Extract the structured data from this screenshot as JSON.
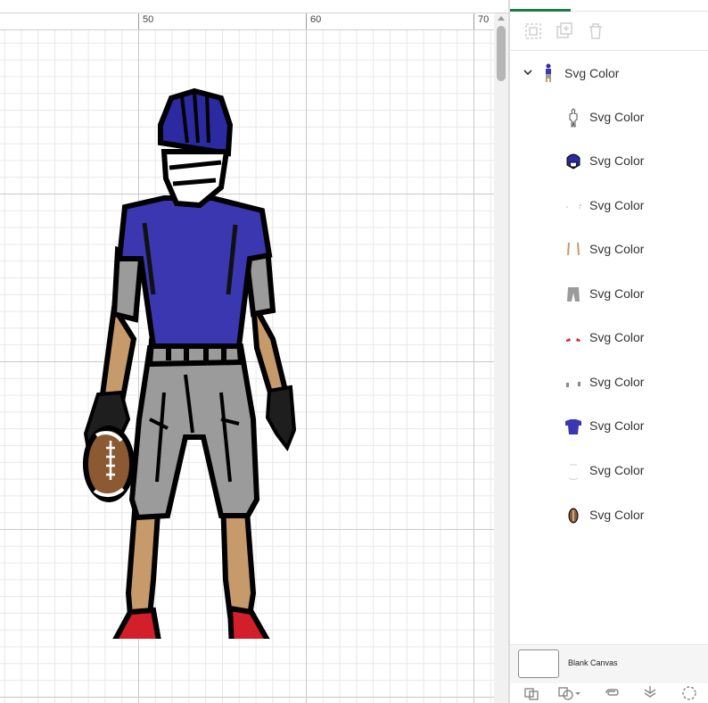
{
  "ruler": {
    "labels": [
      "50",
      "60",
      "70"
    ]
  },
  "layers": {
    "group": {
      "label": "Svg Color",
      "icon": "chevron-down-icon"
    },
    "items": [
      {
        "label": "Svg Color",
        "thumb": "outline"
      },
      {
        "label": "Svg Color",
        "thumb": "helmet"
      },
      {
        "label": "Svg Color",
        "thumb": "specks"
      },
      {
        "label": "Svg Color",
        "thumb": "arms"
      },
      {
        "label": "Svg Color",
        "thumb": "pants"
      },
      {
        "label": "Svg Color",
        "thumb": "shoes"
      },
      {
        "label": "Svg Color",
        "thumb": "socks"
      },
      {
        "label": "Svg Color",
        "thumb": "jersey"
      },
      {
        "label": "Svg Color",
        "thumb": "laces"
      },
      {
        "label": "Svg Color",
        "thumb": "football"
      }
    ]
  },
  "canvas_bar": {
    "label": "Blank Canvas"
  },
  "colors": {
    "accent": "#1d7a4b",
    "jersey": "#3a37b0",
    "pants": "#9b9b9b",
    "skin": "#c79a6b",
    "football": "#8b5a32",
    "cleats": "#e0202c"
  }
}
